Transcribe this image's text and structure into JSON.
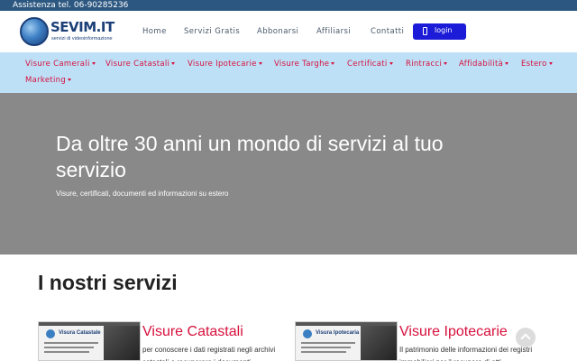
{
  "topbar": {
    "phone": "Assistenza tel. 06-90285236"
  },
  "logo": {
    "name": "SEVIM.IT",
    "tagline": "servizi di videoinformazione"
  },
  "nav": [
    {
      "label": "Home"
    },
    {
      "label": "Servizi Gratis"
    },
    {
      "label": "Abbonarsi"
    },
    {
      "label": "Affiliarsi"
    },
    {
      "label": "Contatti"
    }
  ],
  "login": {
    "label": "login"
  },
  "categories": [
    {
      "label": "Visure Camerali"
    },
    {
      "label": "Visure Catastali"
    },
    {
      "label": "Visure Ipotecarie"
    },
    {
      "label": "Visure Targhe"
    },
    {
      "label": "Certificati"
    },
    {
      "label": "Rintracci"
    },
    {
      "label": "Affidabilità"
    },
    {
      "label": "Estero"
    },
    {
      "label": "Marketing"
    }
  ],
  "hero": {
    "title": "Da oltre 30 anni un mondo di servizi al tuo servizio",
    "subtitle": "Visure, certificati, documenti ed informazioni su estero"
  },
  "services": {
    "title": "I nostri servizi",
    "cards": [
      {
        "title": "Visure Catastali",
        "text": "per conoscere i dati registrati negli archivi catastali e recuperare i documenti",
        "image_brand": "Visura Catastale"
      },
      {
        "title": "Visure Ipotecarie",
        "text": "Il patrimonio delle informazioni dei registri immobiliari per il recupero di atti",
        "image_brand": "Visura Ipotecaria"
      }
    ]
  },
  "colors": {
    "topbar": "#2c5780",
    "category_bar": "#bde0f7",
    "accent": "#d6103c",
    "login": "#1c1cd8",
    "hero": "#898989"
  }
}
